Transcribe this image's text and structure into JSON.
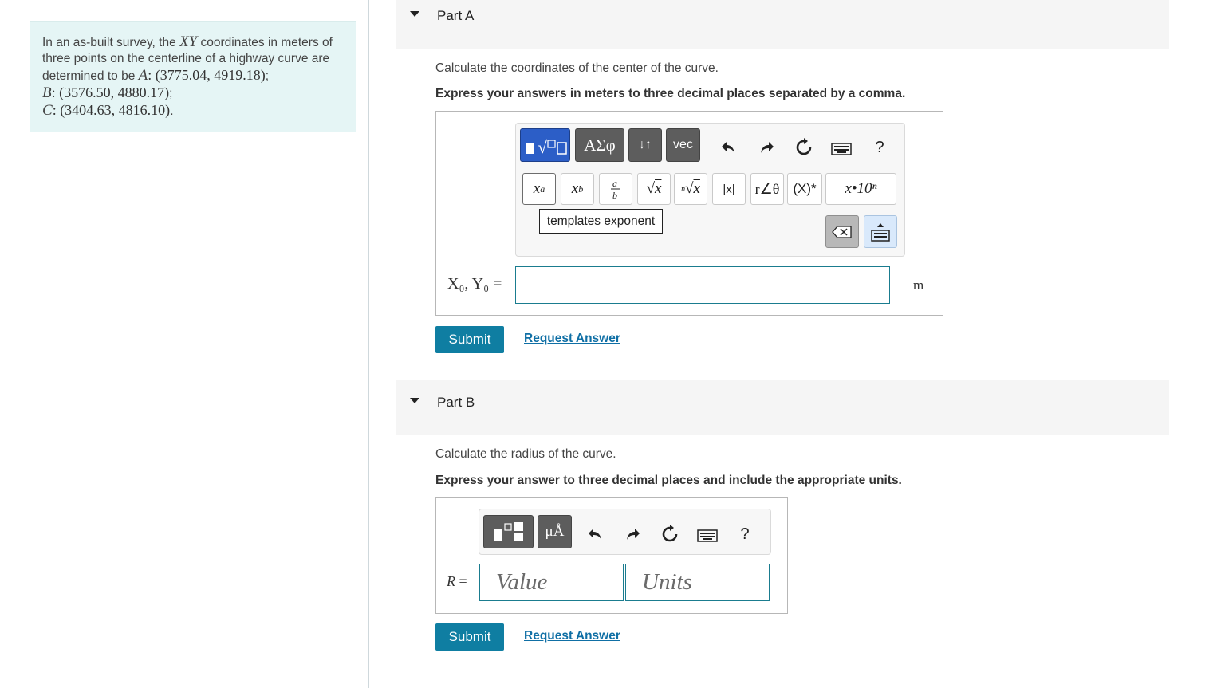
{
  "problem": {
    "t1": "In an as-built survey, the ",
    "xy": "XY",
    "t2": " coordinates in meters of three points on the centerline of a highway curve are determined to be ",
    "a_label": "A",
    "a_coords": ": (3775.04, 4919.18)",
    "semi1": ";",
    "b_label": "B",
    "b_coords": ": (3576.50, 4880.17)",
    "semi2": ";",
    "c_label": "C",
    "c_coords": ": (3404.63, 4816.10)",
    "period": "."
  },
  "partA": {
    "title": "Part A",
    "instruction": "Calculate the coordinates of the center of the curve.",
    "instruction_bold": "Express your answers in meters to three decimal places separated by a comma.",
    "toolbar": {
      "greek": "ΑΣφ",
      "arrows": "↓↑",
      "vec": "vec",
      "help": "?"
    },
    "templates": {
      "abs": "|x|",
      "angle": "r∠θ",
      "conj": "(X)*",
      "sci": "x•10ⁿ"
    },
    "tooltip": "templates exponent",
    "input_label": "X₀, Y₀ =",
    "unit": "m",
    "submit": "Submit",
    "request": "Request Answer"
  },
  "partB": {
    "title": "Part B",
    "instruction": "Calculate the radius of the curve.",
    "instruction_bold": "Express your answer to three decimal places and include the appropriate units.",
    "toolbar": {
      "units": "μÅ",
      "help": "?"
    },
    "input_label": "R =",
    "value_placeholder": "Value",
    "units_placeholder": "Units",
    "submit": "Submit",
    "request": "Request Answer"
  },
  "colors": {
    "accent": "#0f7ea2",
    "problem_bg": "#e5f5f5",
    "toolbar_blue": "#2c5ec7"
  }
}
